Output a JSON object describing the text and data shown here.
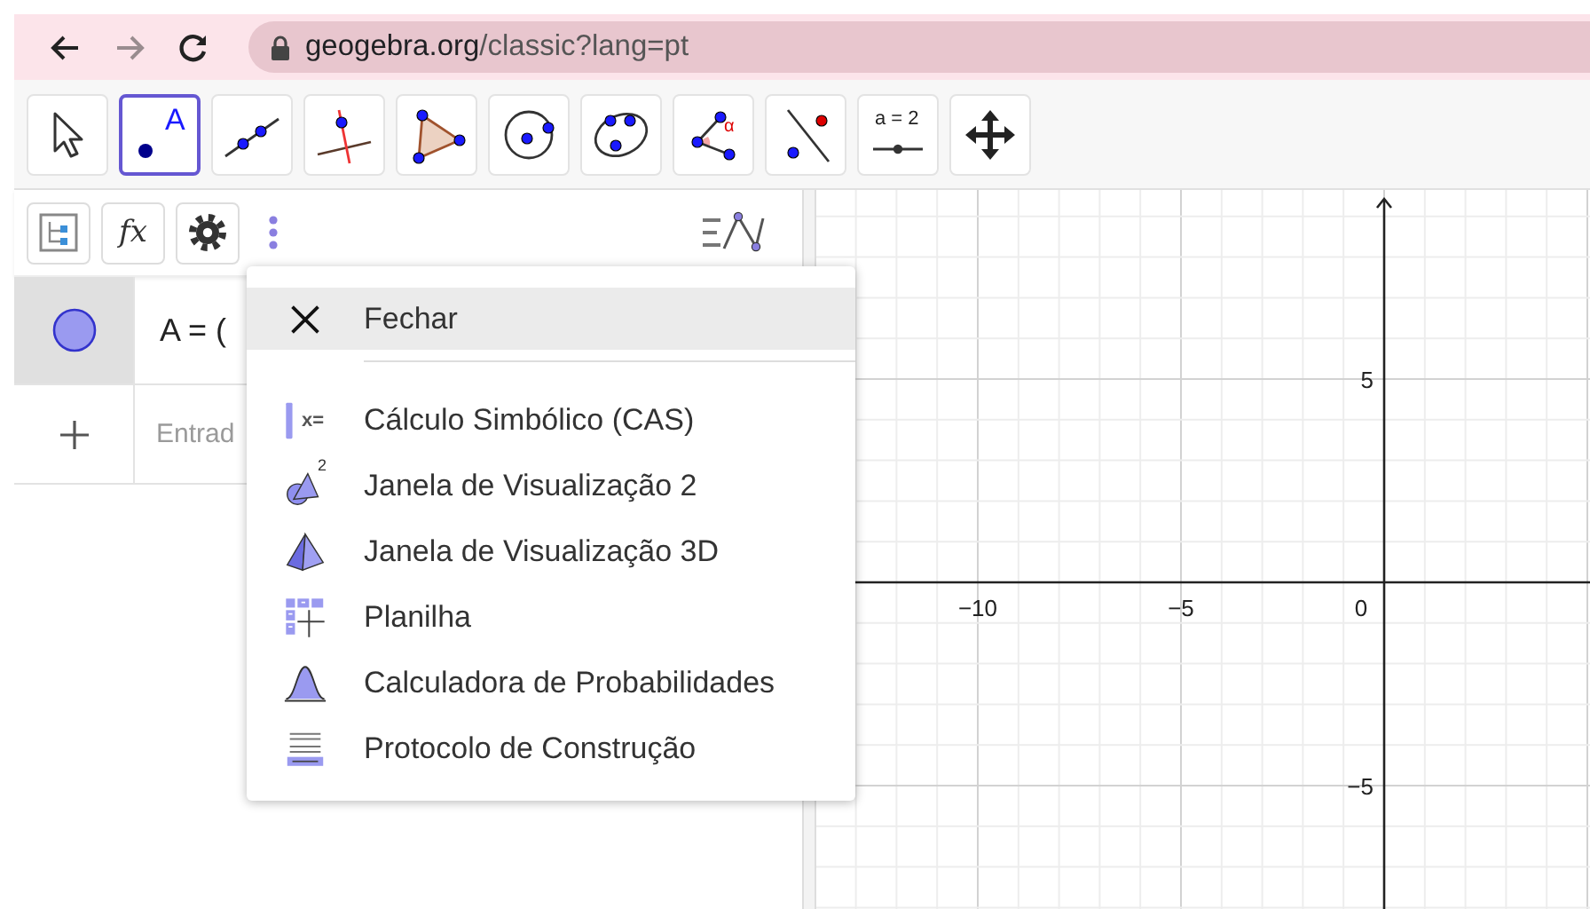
{
  "browser": {
    "url_host": "geogebra.org",
    "url_path": "/classic?lang=pt"
  },
  "toolbar": {
    "tools": [
      {
        "kind": "move",
        "selected": false
      },
      {
        "kind": "point",
        "label": "A",
        "selected": true
      },
      {
        "kind": "line",
        "selected": false
      },
      {
        "kind": "perpendicular",
        "selected": false
      },
      {
        "kind": "polygon",
        "selected": false
      },
      {
        "kind": "circle",
        "selected": false
      },
      {
        "kind": "conic",
        "selected": false
      },
      {
        "kind": "angle",
        "label": "α",
        "selected": false
      },
      {
        "kind": "reflect",
        "selected": false
      },
      {
        "kind": "slider",
        "label": "a = 2",
        "selected": false
      },
      {
        "kind": "move-view",
        "selected": false
      }
    ]
  },
  "algebra": {
    "tools": [
      {
        "kind": "tree"
      },
      {
        "kind": "function",
        "label": "fx"
      },
      {
        "kind": "settings"
      }
    ],
    "rows": [
      {
        "kind": "object",
        "text": "A = ("
      },
      {
        "kind": "input",
        "placeholder": "Entrad"
      }
    ]
  },
  "menu": {
    "items": [
      {
        "kind": "close",
        "label": "Fechar",
        "selected": true
      },
      {
        "kind": "cas",
        "icon_text": "x=",
        "label": "Cálculo Simbólico (CAS)",
        "selected": false
      },
      {
        "kind": "graphics2",
        "icon_text": "2",
        "label": "Janela de Visualização 2",
        "selected": false
      },
      {
        "kind": "graphics3d",
        "label": "Janela de Visualização 3D",
        "selected": false
      },
      {
        "kind": "spreadsheet",
        "label": "Planilha",
        "selected": false
      },
      {
        "kind": "probability",
        "label": "Calculadora de Probabilidades",
        "selected": false
      },
      {
        "kind": "protocol",
        "label": "Protocolo de Construção",
        "selected": false
      }
    ]
  },
  "graphics": {
    "x_labels": [
      "−10",
      "−5",
      "0"
    ],
    "y_labels": [
      "5",
      "−5"
    ]
  }
}
